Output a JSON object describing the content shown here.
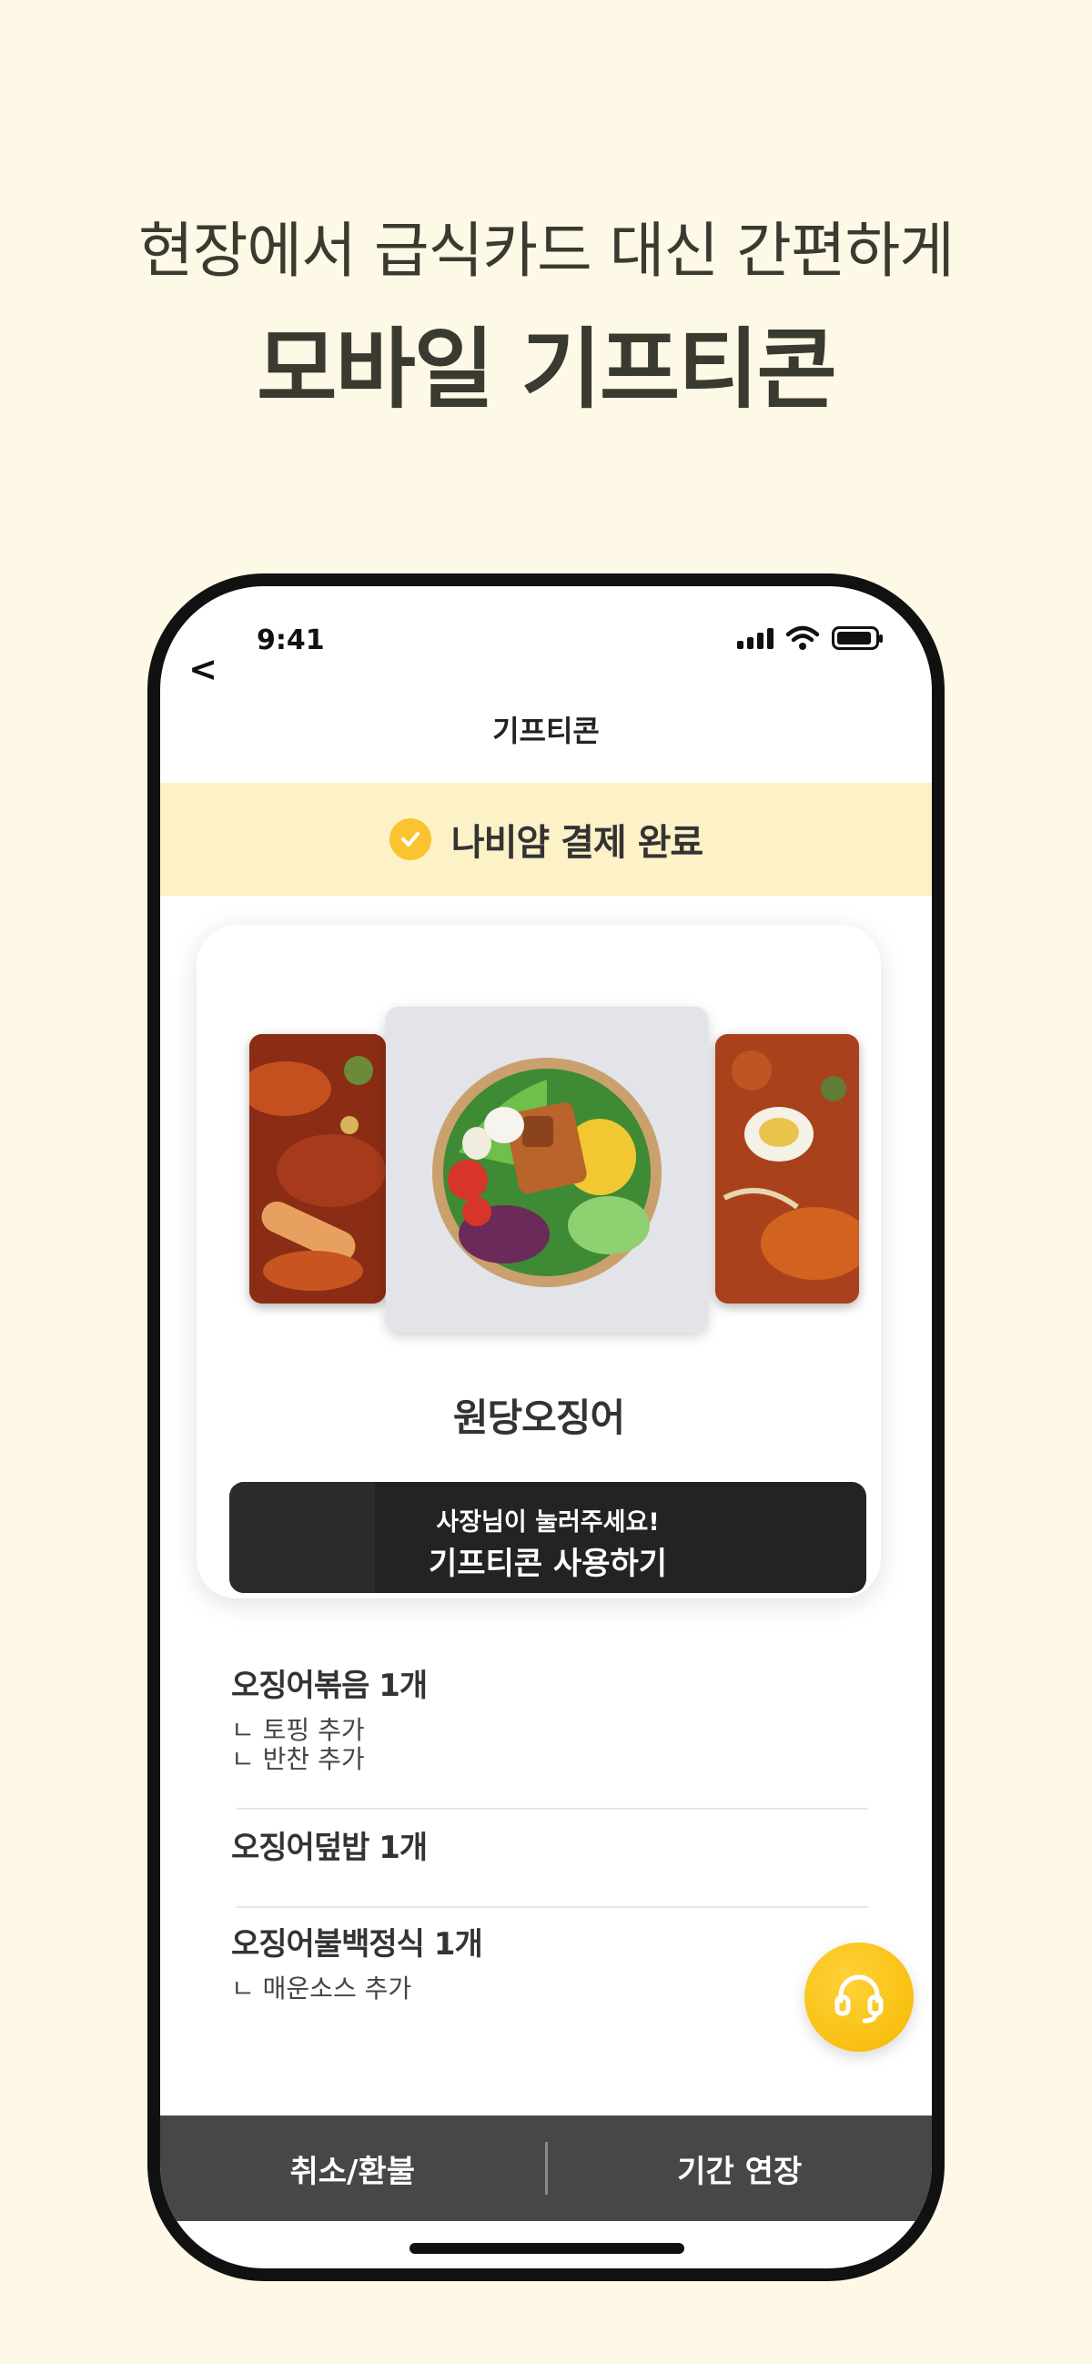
{
  "headline": {
    "line1": "현장에서 급식카드 대신 간편하게",
    "line2": "모바일 기프티콘"
  },
  "status_bar": {
    "time": "9:41",
    "icons": [
      "signal-icon",
      "wifi-icon",
      "battery-icon"
    ]
  },
  "nav": {
    "back_label": "<",
    "title": "기프티콘"
  },
  "banner": {
    "text": "나비얌 결제 완료",
    "icon": "check-circle-icon",
    "color": "#f9c430"
  },
  "card": {
    "store_name": "원당오징어",
    "use_button": {
      "hint": "사장님이 눌러주세요!",
      "label": "기프티콘 사용하기"
    }
  },
  "orders": [
    {
      "name": "오징어볶음 1개",
      "options": [
        "ㄴ 토핑 추가",
        "ㄴ 반찬 추가"
      ]
    },
    {
      "name": "오징어덮밥 1개",
      "options": []
    },
    {
      "name": "오징어불백정식 1개",
      "options": [
        "ㄴ 매운소스 추가"
      ]
    }
  ],
  "fab": {
    "icon": "headset-icon",
    "color": "#f6b800"
  },
  "bottom_bar": {
    "cancel_label": "취소/환불",
    "extend_label": "기간 연장"
  }
}
